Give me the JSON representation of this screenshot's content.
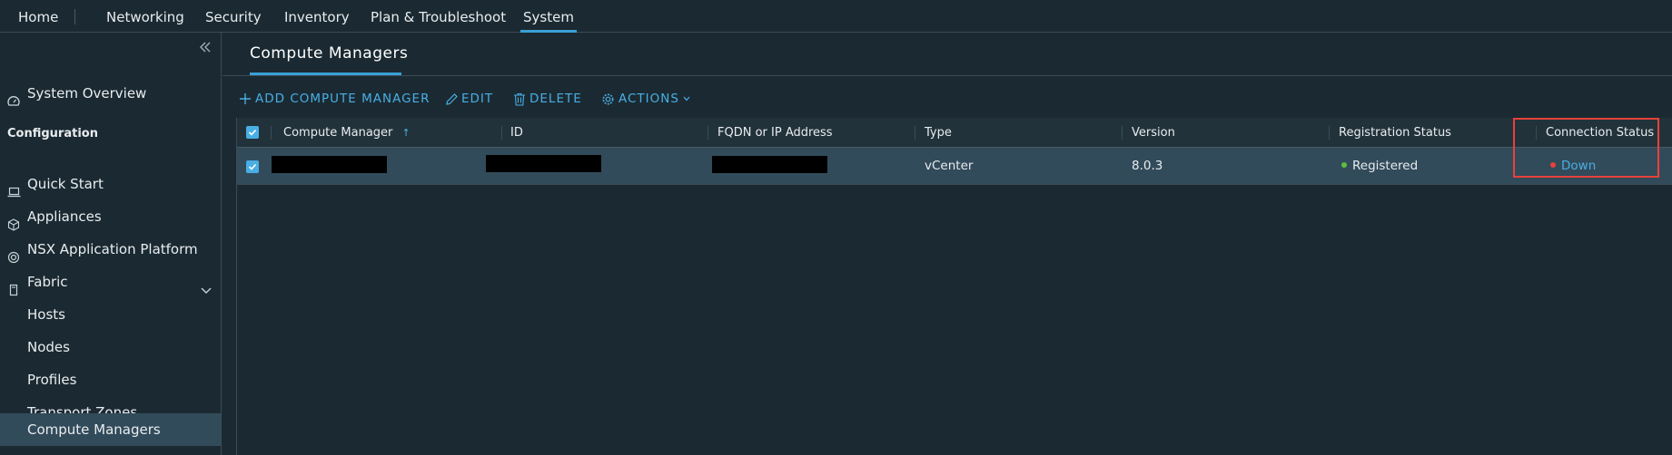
{
  "topnav": {
    "items": [
      {
        "label": "Home"
      },
      {
        "label": "Networking"
      },
      {
        "label": "Security"
      },
      {
        "label": "Inventory"
      },
      {
        "label": "Plan & Troubleshoot"
      },
      {
        "label": "System",
        "active": true
      }
    ]
  },
  "sidebar": {
    "system_overview": "System Overview",
    "configuration_header": "Configuration",
    "quick_start": "Quick Start",
    "appliances": "Appliances",
    "nsx_app_platform": "NSX Application Platform",
    "fabric": "Fabric",
    "hosts": "Hosts",
    "nodes": "Nodes",
    "profiles": "Profiles",
    "transport_zones": "Transport Zones",
    "compute_managers": "Compute Managers"
  },
  "page": {
    "title": "Compute Managers"
  },
  "toolbar": {
    "add": "ADD COMPUTE MANAGER",
    "edit": "EDIT",
    "delete": "DELETE",
    "actions": "ACTIONS"
  },
  "table": {
    "headers": {
      "compute_manager": "Compute Manager",
      "id": "ID",
      "fqdn": "FQDN or IP Address",
      "type": "Type",
      "version": "Version",
      "registration_status": "Registration Status",
      "connection_status": "Connection Status"
    },
    "rows": [
      {
        "selected": true,
        "compute_manager": "",
        "id": "",
        "fqdn": "",
        "type": "vCenter",
        "version": "8.0.3",
        "registration_status": "Registered",
        "connection_status": "Down"
      }
    ]
  },
  "colors": {
    "accent": "#49aee4",
    "registered_dot": "#5fbf3a",
    "down_dot": "#e8413a",
    "highlight": "#e8413a"
  }
}
